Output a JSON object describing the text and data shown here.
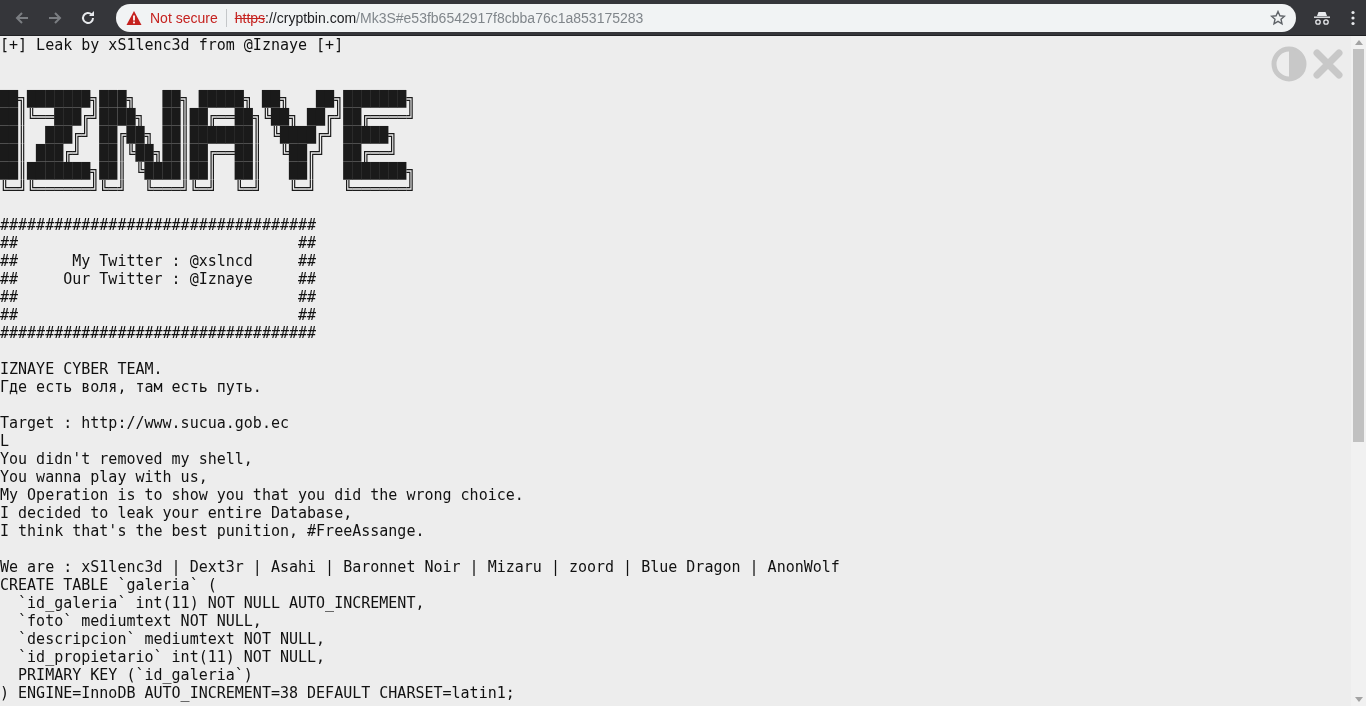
{
  "browser": {
    "nav": [
      {
        "kind": "back",
        "disabled": true
      },
      {
        "kind": "forward",
        "disabled": true
      },
      {
        "kind": "reload",
        "disabled": false
      }
    ],
    "security": "Not secure",
    "url": {
      "scheme": "https",
      "host": "://cryptbin.com",
      "path": "/Mk3S#e53fb6542917f8cbba76c1a853175283"
    }
  },
  "paste": {
    "header": "[+] Leak by xS1lenc3d from @Iznaye [+]",
    "blocks": [
      {
        "kind": "art",
        "lines": [
          "██╗███████╗███╗   ██╗ █████╗ ██╗   ██╗███████╗",
          "██║╚══███╔╝████╗  ██║██╔══██╗╚██╗ ██╔╝██╔════╝",
          "██║  ███╔╝ ██╔██╗ ██║███████║ ╚████╔╝ █████╗  ",
          "██║ ███╔╝  ██║╚██╗██║██╔══██║  ╚██╔╝  ██╔══╝  ",
          "██║███████╗██║ ╚████║██║  ██║   ██║   ███████╗",
          "╚═╝╚══════╝╚═╝  ╚═══╝╚═╝  ╚═╝   ╚═╝   ╚══════╝"
        ]
      },
      {
        "kind": "text",
        "lines": [
          "###################################",
          "##                               ##",
          "##      My Twitter : @xslncd     ##",
          "##     Our Twitter : @Iznaye     ##",
          "##                               ##",
          "##                               ##",
          "###################################"
        ]
      },
      {
        "kind": "text",
        "lines": [
          "IZNAYE CYBER TEAM.",
          "Где есть воля, там есть путь."
        ]
      },
      {
        "kind": "text",
        "lines": [
          "Target : http://www.sucua.gob.ec",
          "L",
          "You didn't removed my shell,",
          "You wanna play with us,",
          "My Operation is to show you that you did the wrong choice.",
          "I decided to leak your entire Database,",
          "I think that's the best punition, #FreeAssange."
        ]
      },
      {
        "kind": "text",
        "lines": [
          "We are : xS1lenc3d | Dext3r | Asahi | Baronnet Noir | Mizaru | zoord | Blue Dragon | AnonWolf",
          "CREATE TABLE `galeria` (",
          "  `id_galeria` int(11) NOT NULL AUTO_INCREMENT,",
          "  `foto` mediumtext NOT NULL,",
          "  `descripcion` mediumtext NOT NULL,",
          "  `id_propietario` int(11) NOT NULL,",
          "  PRIMARY KEY (`id_galeria`)",
          ") ENGINE=InnoDB AUTO_INCREMENT=38 DEFAULT CHARSET=latin1;"
        ]
      }
    ]
  }
}
